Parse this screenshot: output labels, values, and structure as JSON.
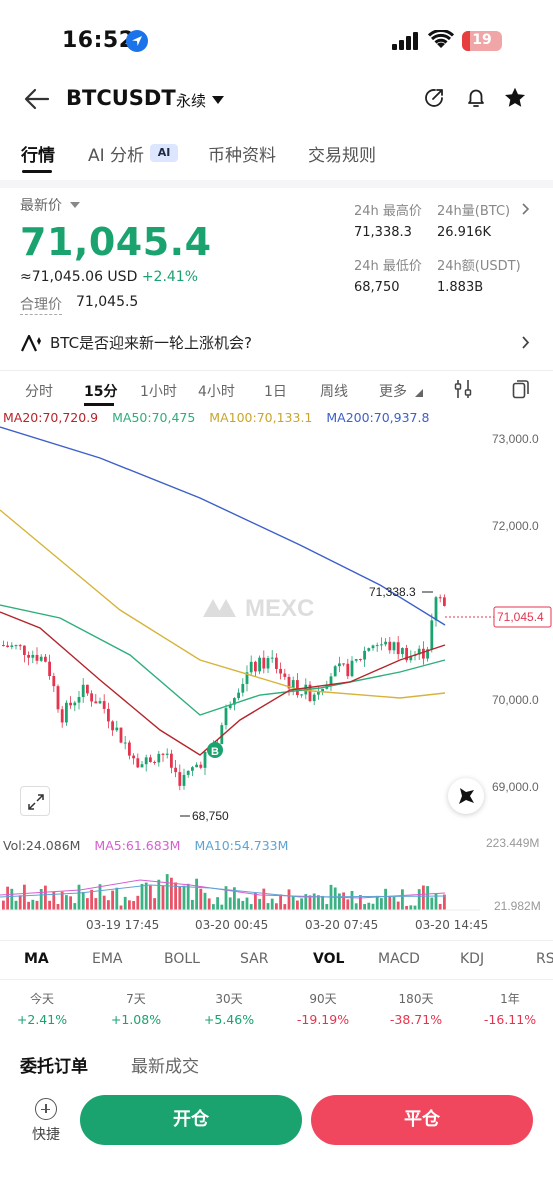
{
  "status_bar": {
    "time": "16:52",
    "battery": "19"
  },
  "header": {
    "symbol": "BTCUSDT",
    "contract_type": "永续"
  },
  "tabs": [
    {
      "label": "行情"
    },
    {
      "label": "AI 分析"
    },
    {
      "label": "币种资料"
    },
    {
      "label": "交易规则"
    }
  ],
  "ai_badge": "AI",
  "ticker": {
    "latest_label": "最新价",
    "price": "71,045.4",
    "usd_value": "≈71,045.06 USD",
    "change": "+2.41%",
    "fair_price_label": "合理价",
    "fair_price": "71,045.5",
    "high_label": "24h 最高价",
    "high": "71,338.3",
    "vol_btc_label": "24h量(BTC)",
    "vol_btc": "26.916K",
    "low_label": "24h 最低价",
    "low": "68,750",
    "amt_label": "24h额(USDT)",
    "amt": "1.883B"
  },
  "question": "BTC是否迎来新一轮上涨机会?",
  "timeframes": [
    "分时",
    "15分",
    "1小时",
    "4小时",
    "1日",
    "周线",
    "更多"
  ],
  "ma_legend": {
    "ma20": "MA20:70,720.9",
    "ma50": "MA50:70,475",
    "ma100": "MA100:70,133.1",
    "ma200": "MA200:70,937.8"
  },
  "chart": {
    "y_labels": [
      "73,000.0",
      "72,000.0",
      "70,000.0",
      "69,000.0"
    ],
    "high_marker": "71,338.3",
    "low_marker": "68,750",
    "current_price_tag": "71,045.4",
    "watermark": "MEXC",
    "buy_marker": "B",
    "vol_y_top": "223.449M",
    "vol_y_bottom": "21.982M",
    "x_labels": [
      "03-19 17:45",
      "03-20 00:45",
      "03-20 07:45",
      "03-20 14:45"
    ]
  },
  "vol_legend": {
    "vol": "Vol:24.086M",
    "ma5": "MA5:61.683M",
    "ma10": "MA10:54.733M"
  },
  "indicators": [
    "MA",
    "EMA",
    "BOLL",
    "SAR",
    "VOL",
    "MACD",
    "KDJ",
    "RS"
  ],
  "performance": [
    {
      "label": "今天",
      "value": "+2.41%"
    },
    {
      "label": "7天",
      "value": "+1.08%"
    },
    {
      "label": "30天",
      "value": "+5.46%"
    },
    {
      "label": "90天",
      "value": "-19.19%"
    },
    {
      "label": "180天",
      "value": "-38.71%"
    },
    {
      "label": "1年",
      "value": "-16.11%"
    }
  ],
  "orderbook_tabs": [
    "委托订单",
    "最新成交"
  ],
  "bottom": {
    "quick": "快捷",
    "open": "开仓",
    "close": "平仓"
  },
  "colors": {
    "up": "#1aa36f",
    "down": "#e5354e",
    "ma20": "#b3262c",
    "ma50": "#2eae7a",
    "ma100": "#d6b43a",
    "ma200": "#3c5fc9"
  }
}
